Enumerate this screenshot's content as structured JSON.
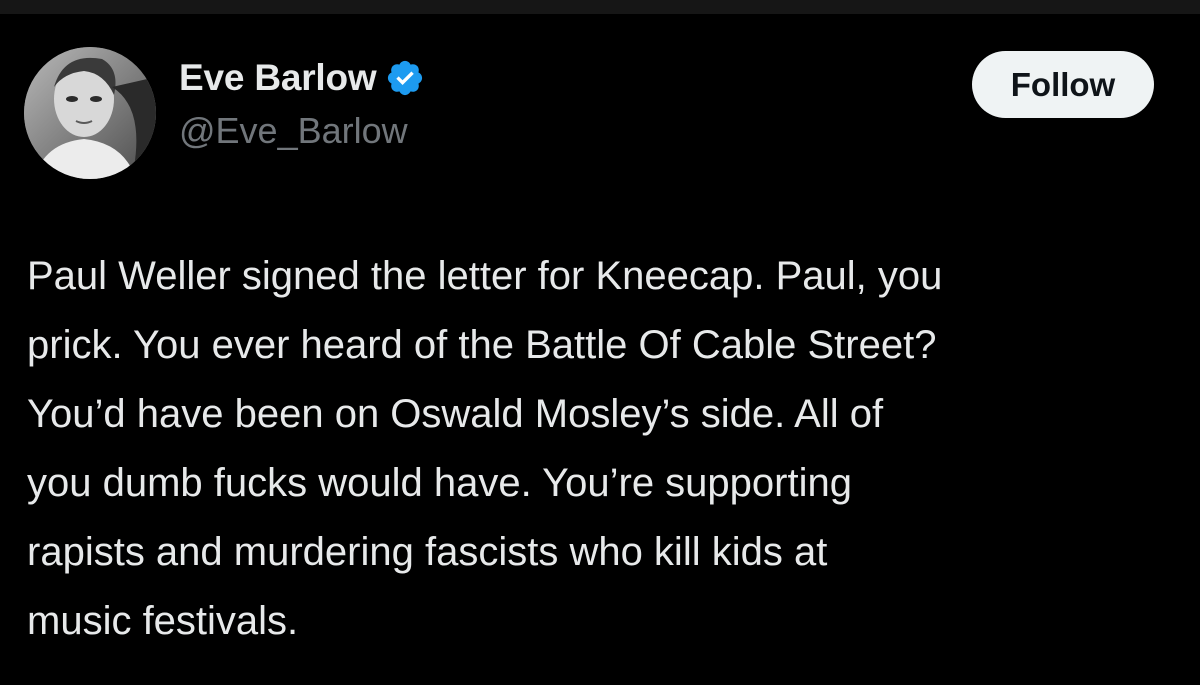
{
  "tweet": {
    "author": {
      "display_name": "Eve Barlow",
      "handle": "@Eve_Barlow",
      "verified": true,
      "verified_color": "#1d9bf0",
      "avatar_icon": "profile-photo"
    },
    "follow_label": "Follow",
    "text_lines": [
      "Paul Weller signed the letter for Kneecap. Paul, you",
      "prick. You ever heard of the Battle Of Cable Street?",
      "You’d have been on Oswald Mosley’s side. All of",
      "you dumb fucks would have. You’re supporting",
      "rapists and murdering fascists who kill kids at",
      "music festivals."
    ]
  },
  "colors": {
    "background": "#000000",
    "primary_text": "#e7e9ea",
    "secondary_text": "#71767b",
    "button_background": "#eff3f4"
  }
}
